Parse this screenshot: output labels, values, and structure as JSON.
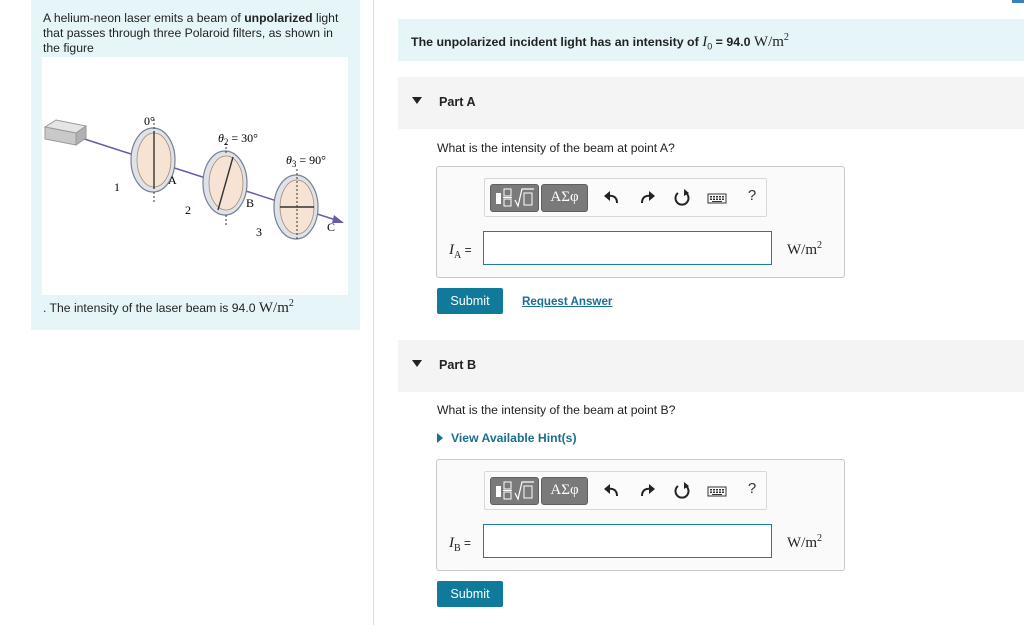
{
  "problem": {
    "text_before": "A helium-neon laser emits a beam of ",
    "text_bold": "unpolarized",
    "text_after": " light that passes through three Polaroid filters, as shown in the figure",
    "figure": {
      "angle_1": "0°",
      "angle_2_symbol": "θ",
      "angle_2_sub": "2",
      "angle_2_value": " = 30°",
      "angle_3_symbol": "θ",
      "angle_3_sub": "3",
      "angle_3_value": " = 90°",
      "filter_1": "1",
      "filter_2": "2",
      "filter_3": "3",
      "point_a": "A",
      "point_b": "B",
      "point_c": "C"
    },
    "intensity_prefix": ". The intensity of the laser beam is 94.0 ",
    "intensity_unit": "W/m",
    "intensity_unit_exp": "2"
  },
  "given": {
    "text": "The unpolarized incident light has an intensity of ",
    "symbol": "I",
    "symbol_sub": "0",
    "eq": " = 94.0 ",
    "unit": "W/m",
    "unit_exp": "2"
  },
  "toolbar": {
    "symbols_label": "ΑΣφ",
    "help_label": "?"
  },
  "partA": {
    "title": "Part A",
    "question": "What is the intensity of the beam at point A?",
    "var_symbol": "I",
    "var_sub": "A",
    "var_eq": " =",
    "input_value": "",
    "unit": "W/m",
    "unit_exp": "2",
    "submit_label": "Submit",
    "request_answer_label": "Request Answer"
  },
  "partB": {
    "title": "Part B",
    "question": "What is the intensity of the beam at point B?",
    "hint_label": "View Available Hint(s)",
    "var_symbol": "I",
    "var_sub": "B",
    "var_eq": " =",
    "input_value": "",
    "unit": "W/m",
    "unit_exp": "2",
    "submit_label": "Submit"
  },
  "colors": {
    "panel_bg": "#e6f6f8",
    "part_header_bg": "#f4f4f4",
    "submit_bg": "#0f7a99",
    "link": "#1a6f8f",
    "input_border": "#1a7ea6",
    "filter_fill": "#f6e3d3",
    "beam": "#6a5aa8"
  }
}
